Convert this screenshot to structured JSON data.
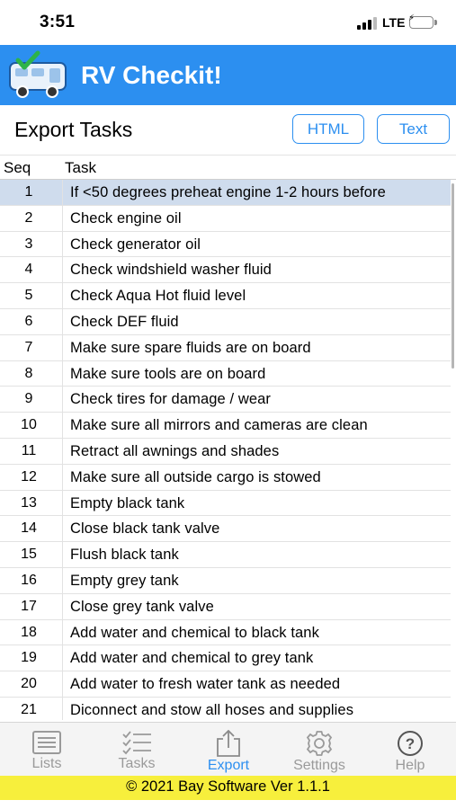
{
  "status_bar": {
    "time": "3:51",
    "network": "LTE"
  },
  "app": {
    "title": "RV Checkit!",
    "logo_icon": "rv-checkmark-logo",
    "header_color": "#2c8ff0"
  },
  "page": {
    "title": "Export Tasks",
    "buttons": {
      "html_label": "HTML",
      "text_label": "Text"
    }
  },
  "table": {
    "columns": [
      "Seq",
      "Task"
    ],
    "selected_seq": "1",
    "rows": [
      {
        "seq": "1",
        "task": "If <50 degrees preheat engine 1-2 hours before"
      },
      {
        "seq": "2",
        "task": "Check engine oil"
      },
      {
        "seq": "3",
        "task": "Check generator oil"
      },
      {
        "seq": "4",
        "task": "Check windshield washer fluid"
      },
      {
        "seq": "5",
        "task": "Check Aqua Hot fluid level"
      },
      {
        "seq": "6",
        "task": "Check DEF fluid"
      },
      {
        "seq": "7",
        "task": "Make sure spare fluids are on board"
      },
      {
        "seq": "8",
        "task": "Make sure tools are on board"
      },
      {
        "seq": "9",
        "task": "Check tires for damage / wear"
      },
      {
        "seq": "10",
        "task": "Make sure all mirrors and cameras are clean"
      },
      {
        "seq": "11",
        "task": "Retract all awnings and shades"
      },
      {
        "seq": "12",
        "task": "Make sure all outside cargo is stowed"
      },
      {
        "seq": "13",
        "task": "Empty black tank"
      },
      {
        "seq": "14",
        "task": "Close black tank valve"
      },
      {
        "seq": "15",
        "task": "Flush black tank"
      },
      {
        "seq": "16",
        "task": "Empty grey tank"
      },
      {
        "seq": "17",
        "task": "Close grey tank valve"
      },
      {
        "seq": "18",
        "task": "Add water and chemical to black tank"
      },
      {
        "seq": "19",
        "task": "Add water and chemical to grey tank"
      },
      {
        "seq": "20",
        "task": "Add water to fresh water tank as needed"
      },
      {
        "seq": "21",
        "task": "Diconnect and stow all hoses and supplies"
      }
    ]
  },
  "tab_bar": {
    "tabs": [
      {
        "label": "Lists",
        "icon": "list-icon",
        "active": false
      },
      {
        "label": "Tasks",
        "icon": "checklist-icon",
        "active": false
      },
      {
        "label": "Export",
        "icon": "share-icon",
        "active": true
      },
      {
        "label": "Settings",
        "icon": "gear-icon",
        "active": false
      },
      {
        "label": "Help",
        "icon": "help-icon",
        "active": false
      }
    ]
  },
  "footer": {
    "text": "© 2021 Bay Software Ver 1.1.1",
    "color": "#f7ef3c"
  }
}
